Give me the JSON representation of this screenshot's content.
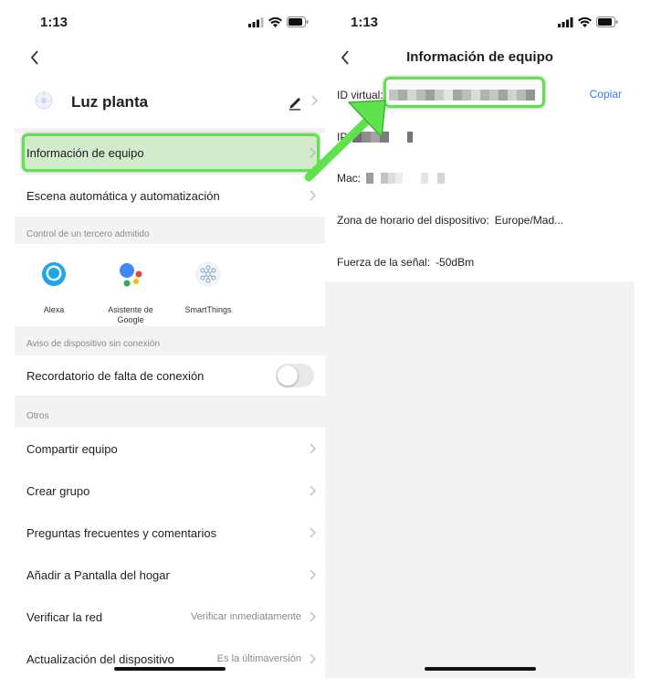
{
  "left": {
    "status_time": "1:13",
    "device_name": "Luz planta",
    "rows": {
      "info": "Información de equipo",
      "scene": "Escena automática y automatización",
      "share": "Compartir equipo",
      "group": "Crear grupo",
      "faq": "Preguntas frecuentes y comentarios",
      "home": "Añadir a Pantalla del hogar",
      "network": "Verificar la red",
      "network_value": "Verificar inmediatamente",
      "update": "Actualización del dispositivo",
      "update_value": "Es la últimaversión",
      "offline": "Recordatorio de falta de conexión"
    },
    "sections": {
      "third_party": "Control de un tercero admitido",
      "offline": "Aviso de dispositivo sin conexión",
      "others": "Otros"
    },
    "third_party": [
      {
        "label": "Alexa",
        "icon": "alexa-icon"
      },
      {
        "label": "Asistente de Google",
        "icon": "google-assistant-icon"
      },
      {
        "label": "SmartThings",
        "icon": "smartthings-icon"
      }
    ],
    "offline_toggle_on": false
  },
  "right": {
    "status_time": "1:13",
    "title": "Información de equipo",
    "virtual_id_label": "ID virtual:",
    "copy_label": "Copiar",
    "ip_label": "IP",
    "mac_label": "Mac:",
    "timezone_label": "Zona de horario del dispositivo:",
    "timezone_value": "Europe/Mad...",
    "signal_label": "Fuerza de la señal:",
    "signal_value": "-50dBm"
  },
  "colors": {
    "highlight": "#5fe24e",
    "link": "#2f80ed",
    "background": "#f3f3f3"
  }
}
